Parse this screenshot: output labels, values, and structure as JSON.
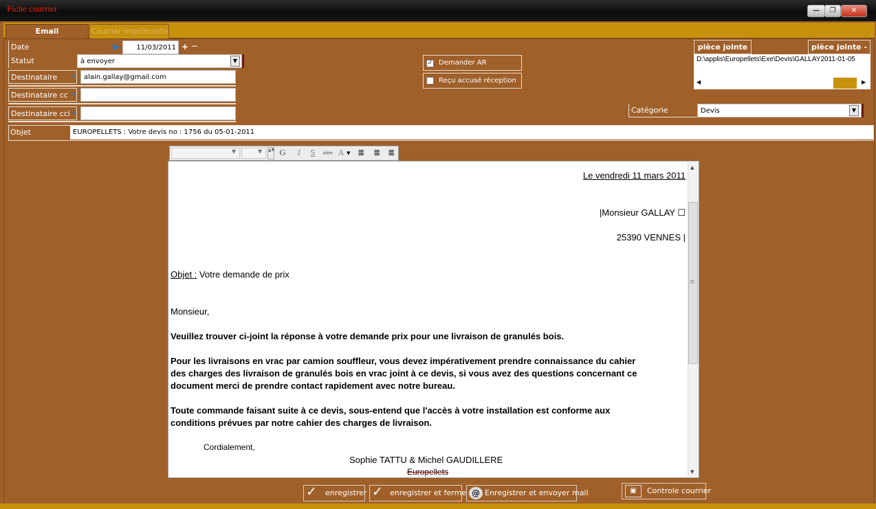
{
  "window": {
    "title": "Fiche  courrier",
    "minimize": "—",
    "restore": "❐",
    "close": "✕"
  },
  "tabs": [
    {
      "label": "Email"
    },
    {
      "label": "Courrier imprimante"
    }
  ],
  "form": {
    "date": {
      "label": "Date",
      "value": "11/03/2011",
      "plus": "+",
      "minus": "−"
    },
    "statut": {
      "label": "Statut",
      "value": "à envoyer"
    },
    "destinataire": {
      "label": "Destinataire",
      "value": "alain.gallay@gmail.com"
    },
    "destinataire_cc": {
      "label": "Destinataire cc",
      "value": ""
    },
    "destinataire_cci": {
      "label": "Destinataire cci",
      "value": ""
    },
    "objet": {
      "label": "Objet",
      "value": "EUROPELLETS : Votre  devis no : 1756 du 05-01-2011"
    },
    "demander_ar": {
      "label": "Demander AR",
      "checked": true
    },
    "recu_accuse": {
      "label": "Reçu accusé réception",
      "checked": false
    },
    "categorie": {
      "label": "Catégorie",
      "value": "Devis"
    }
  },
  "attachments": {
    "add_label": "pièce jointe +",
    "remove_label": "pièce jointe -",
    "path": "D:\\applis\\Europellets\\Exe\\Devis\\GALLAY2011-01-05"
  },
  "editor_toolbar": {
    "bold": "G",
    "italic": "I",
    "underline": "S",
    "strike": "abc",
    "font_color": "A"
  },
  "letter": {
    "date_line": "Le vendredi 11 mars 2011",
    "recipient_name": "|Monsieur GALLAY ☐",
    "recipient_city": "25390 VENNES |",
    "objet_label": "Objet :",
    "objet_text": " Votre demande de prix",
    "salutation": "Monsieur,",
    "p1": "Veuillez trouver ci-joint la réponse à votre demande prix pour une livraison de granulés bois.",
    "p2_l1": "Pour les livraisons en vrac par camion souffleur, vous devez impérativement prendre connaissance du cahier",
    "p2_l2": "des charges des livraison de granulés bois en vrac joint à ce devis, si vous avez des questions concernant ce",
    "p2_l3": "document merci de prendre contact rapidement avec notre bureau.",
    "p3_l1": "Toute commande faisant suite à ce devis, sous-entend que l'accès à votre installation est conforme aux",
    "p3_l2": "conditions prévues par notre cahier des charges de livraison.",
    "closing": "Cordialement,",
    "signature": "Sophie TATTU & Michel  GAUDILLERE",
    "company": "Europellets"
  },
  "buttons": {
    "save": "enregistrer",
    "save_close": "enregistrer et fermer",
    "save_send": "Enregistrer et envoyer mail",
    "control": "Controle courrier"
  },
  "colors": {
    "background": "#a0602a",
    "accent": "#c6920d",
    "title": "#ee2200"
  }
}
